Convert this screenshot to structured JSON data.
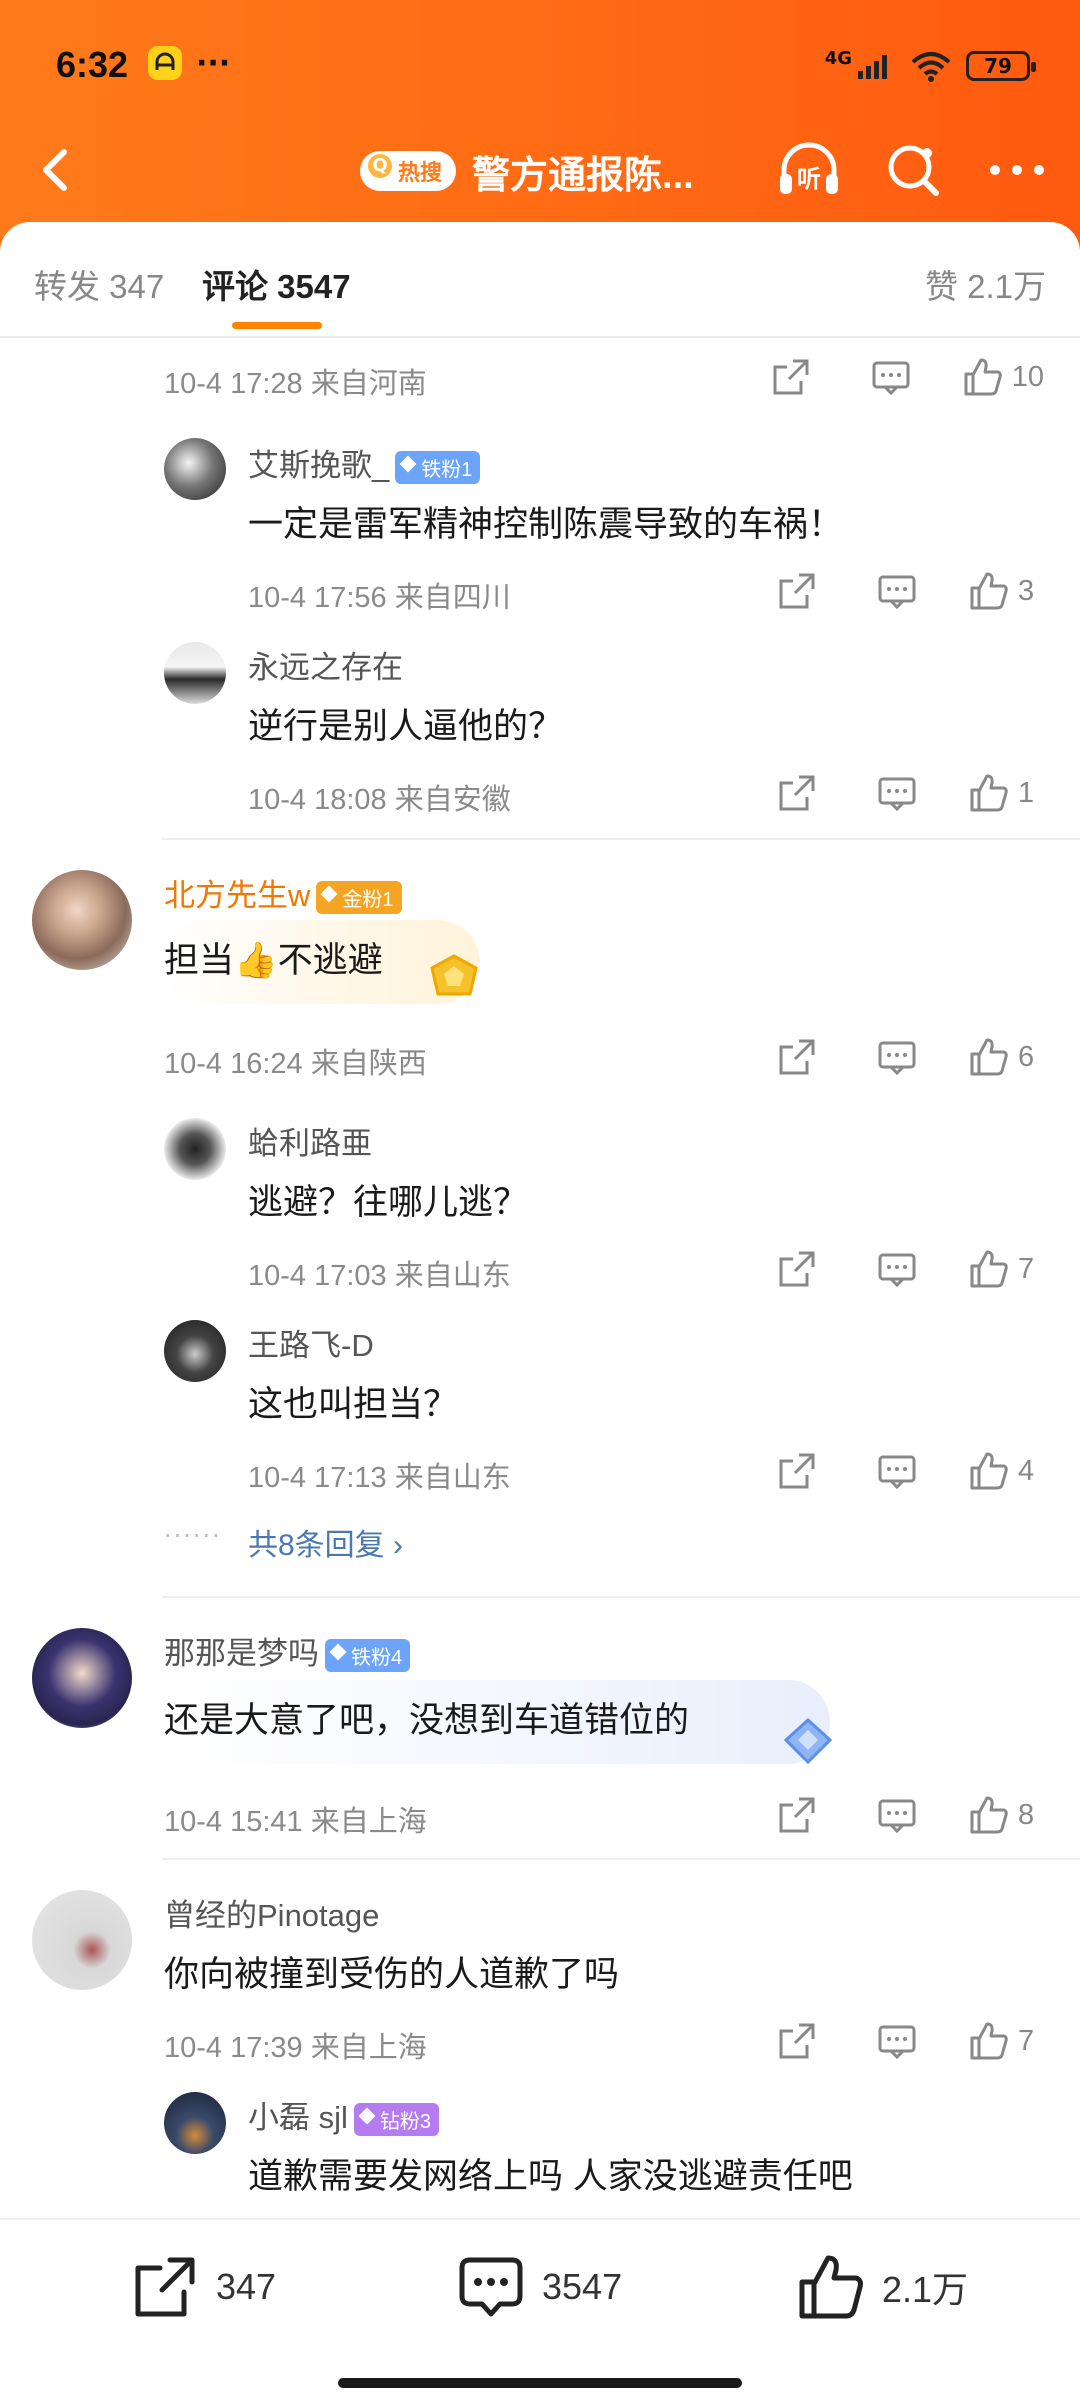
{
  "status_bar": {
    "time": "6:32",
    "network": "4G",
    "battery": "79"
  },
  "nav": {
    "hot_badge": "热搜",
    "title": "警方通报陈...",
    "listen_label": "听"
  },
  "tabs": {
    "repost": "转发 347",
    "comments": "评论 3547",
    "likes": "赞 2.1万"
  },
  "comments": [
    {
      "meta": "10-4 17:28  来自河南",
      "likes": "10"
    },
    {
      "user": "艾斯挽歌_",
      "badge": "铁粉1",
      "text": "一定是雷军精神控制陈震导致的车祸！",
      "meta": "10-4 17:56  来自四川",
      "likes": "3"
    },
    {
      "user": "永远之存在",
      "text": "逆行是别人逼他的？",
      "meta": "10-4 18:08  来自安徽",
      "likes": "1"
    },
    {
      "user": "北方先生w",
      "badge": "金粉1",
      "text": "担当👍不逃避",
      "meta": "10-4 16:24  来自陕西",
      "likes": "6"
    },
    {
      "user": "蛤利路亜",
      "text": "逃避？往哪儿逃？",
      "meta": "10-4 17:03  来自山东",
      "likes": "7"
    },
    {
      "user": "王路飞-D",
      "text": "这也叫担当？",
      "meta": "10-4 17:13  来自山东",
      "likes": "4"
    },
    {
      "more": "共8条回复"
    },
    {
      "user": "那那是梦吗",
      "badge": "铁粉4",
      "text": "还是大意了吧，没想到车道错位的",
      "meta": "10-4 15:41  来自上海",
      "likes": "8"
    },
    {
      "user": "曾经的Pinotage",
      "text": "你向被撞到受伤的人道歉了吗",
      "meta": "10-4 17:39  来自上海",
      "likes": "7"
    },
    {
      "user": "小磊 sjl",
      "badge": "钻粉3",
      "text": "道歉需要发网络上吗 人家没逃避责任吧"
    }
  ],
  "bottom_bar": {
    "repost": "347",
    "comment": "3547",
    "like": "2.1万"
  },
  "colors": {
    "header": "#ff6a13",
    "accent": "#ff8200",
    "link": "#4a78b0"
  }
}
